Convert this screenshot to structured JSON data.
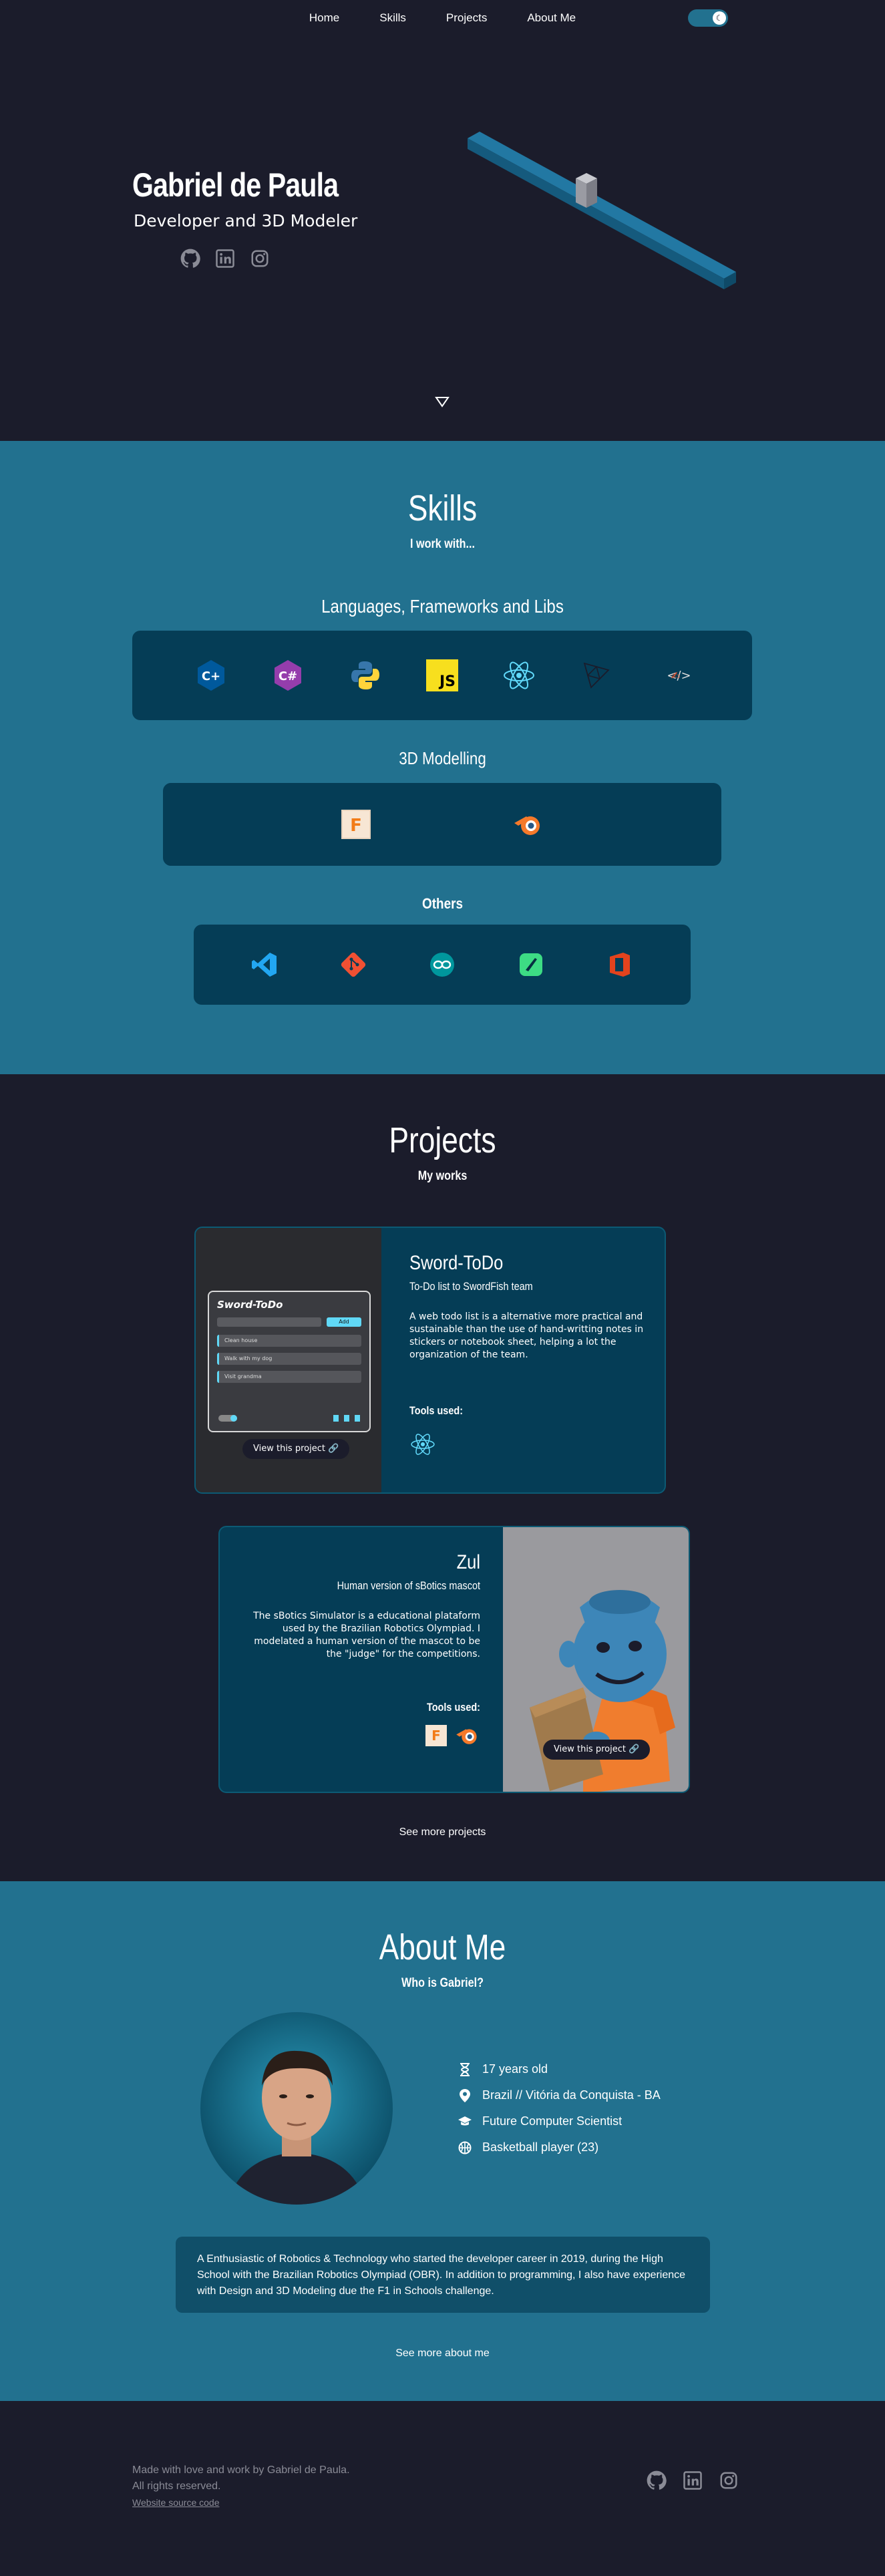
{
  "nav": {
    "links": [
      "Home",
      "Skills",
      "Projects",
      "About Me"
    ],
    "theme_toggle_icon": "moon-icon"
  },
  "hero": {
    "name": "Gabriel de Paula",
    "role": "Developer and 3D Modeler",
    "social": [
      "github-icon",
      "linkedin-icon",
      "instagram-icon"
    ]
  },
  "skills": {
    "title": "Skills",
    "subtitle": "I work with...",
    "groups": [
      {
        "title": "Languages, Frameworks and Libs",
        "icons": [
          "cpp-icon",
          "csharp-icon",
          "python-icon",
          "javascript-icon",
          "react-icon",
          "threejs-icon",
          "html-css-icon"
        ]
      },
      {
        "title": "3D Modelling",
        "icons": [
          "fusion360-icon",
          "blender-icon"
        ]
      },
      {
        "title": "Others",
        "icons": [
          "vscode-icon",
          "git-icon",
          "arduino-icon",
          "android-studio-icon",
          "office-icon"
        ]
      }
    ],
    "js_badge": "JS",
    "html_badge": "</>"
  },
  "projects": {
    "title": "Projects",
    "subtitle": "My works",
    "items": [
      {
        "title": "Sword-ToDo",
        "subtitle": "To-Do list to SwordFish team",
        "description": "A web todo list is a alternative more practical and sustainable than the use of hand-writting notes in stickers or notebook sheet, helping a lot the organization of the team.",
        "tools_label": "Tools used:",
        "tools": [
          "react-icon"
        ],
        "view_label": "View this project",
        "screenshot": {
          "app_title": "Sword-ToDo",
          "add_label": "Add",
          "tasks": [
            "Clean house",
            "Walk with my dog",
            "Visit grandma"
          ]
        }
      },
      {
        "title": "Zul",
        "subtitle": "Human version of sBotics mascot",
        "description": "The sBotics Simulator is a educational plataform used by the Brazilian Robotics Olympiad. I modelated a human version of the mascot to be the \"judge\" for the competitions.",
        "tools_label": "Tools used:",
        "tools": [
          "fusion360-icon",
          "blender-icon"
        ],
        "view_label": "View this project"
      }
    ],
    "see_more": "See more projects"
  },
  "about": {
    "title": "About Me",
    "subtitle": "Who is Gabriel?",
    "facts": [
      {
        "icon": "hourglass-icon",
        "text": "17 years old"
      },
      {
        "icon": "location-pin-icon",
        "text": "Brazil  //  Vitória da Conquista - BA"
      },
      {
        "icon": "graduation-cap-icon",
        "text": "Future Computer Scientist"
      },
      {
        "icon": "basketball-icon",
        "text": "Basketball player (23)"
      }
    ],
    "bio": "A Enthusiastic of Robotics & Technology who started the developer career in 2019, during the High School with the Brazilian Robotics Olympiad (OBR). In addition to programming, I also have experience with Design and 3D Modeling due the F1 in Schools challenge.",
    "see_more": "See more about me"
  },
  "footer": {
    "line1": "Made with love and work by Gabriel de Paula.",
    "line2": "All rights reserved.",
    "source_link": "Website source code",
    "social": [
      "github-icon",
      "linkedin-icon",
      "instagram-icon"
    ]
  },
  "colors": {
    "dark_bg": "#1b1c2b",
    "teal_bg": "#22718f",
    "panel_bg": "#053d56"
  }
}
